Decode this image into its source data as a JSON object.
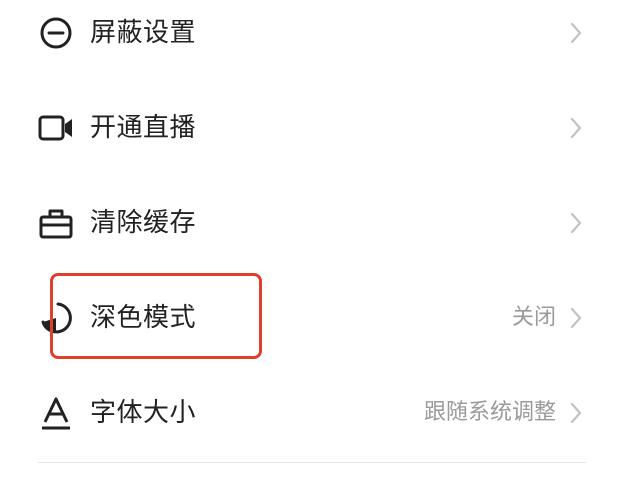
{
  "settings": {
    "items": [
      {
        "label": "屏蔽设置",
        "value": "",
        "icon": "block-circle-icon"
      },
      {
        "label": "开通直播",
        "value": "",
        "icon": "video-camera-icon"
      },
      {
        "label": "清除缓存",
        "value": "",
        "icon": "toolbox-icon"
      },
      {
        "label": "深色模式",
        "value": "关闭",
        "icon": "dark-mode-icon"
      },
      {
        "label": "字体大小",
        "value": "跟随系统调整",
        "icon": "font-size-icon"
      }
    ]
  },
  "colors": {
    "text": "#222222",
    "secondary_text": "#9a9a9a",
    "chevron": "#c2c2c2",
    "divider": "#e6e6e6",
    "highlight": "#e0402a"
  }
}
